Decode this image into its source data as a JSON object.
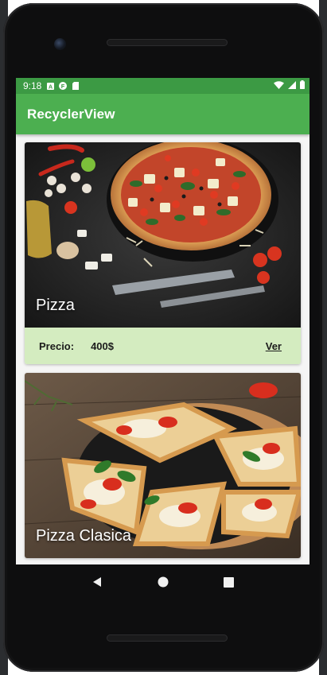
{
  "status_bar": {
    "time": "9:18",
    "icons_left": [
      "a-notification-icon",
      "f-notification-icon",
      "sd-card-icon"
    ],
    "icons_right": [
      "wifi-icon",
      "signal-icon",
      "battery-icon"
    ],
    "color": "#3c9a44"
  },
  "app_bar": {
    "title": "RecyclerView",
    "color": "#4caf50"
  },
  "items": [
    {
      "title": "Pizza",
      "price_label": "Precio:",
      "price": "400$",
      "action": "Ver"
    },
    {
      "title": "Pizza Clasica"
    }
  ],
  "footer_color": "#d4ecc0",
  "nav_bar": {
    "buttons": [
      "back-icon",
      "home-icon",
      "recents-icon"
    ]
  }
}
